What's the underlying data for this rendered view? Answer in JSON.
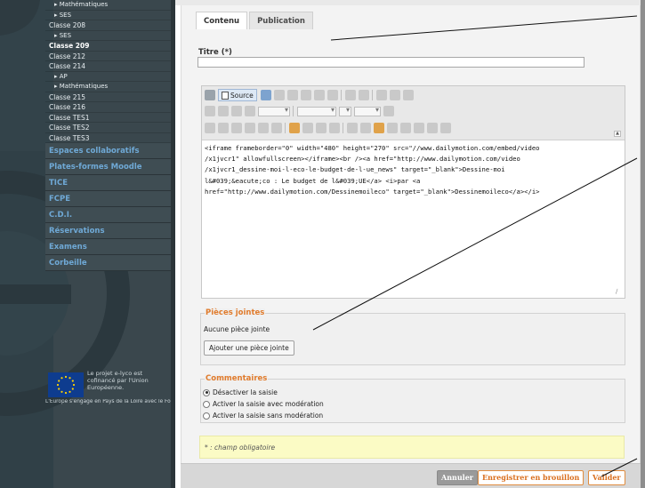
{
  "sidebar": {
    "top_items": [
      {
        "label": "▸ Mathématiques",
        "nested": true,
        "active": false
      },
      {
        "label": "▸ SES",
        "nested": true,
        "active": false
      },
      {
        "label": "Classe 208",
        "nested": false,
        "active": false
      },
      {
        "label": "▸ SES",
        "nested": true,
        "active": false
      },
      {
        "label": "Classe 209",
        "nested": false,
        "active": true
      },
      {
        "label": "Classe 212",
        "nested": false,
        "active": false
      },
      {
        "label": "Classe 214",
        "nested": false,
        "active": false
      },
      {
        "label": "▸ AP",
        "nested": true,
        "active": false
      },
      {
        "label": "▸ Mathématiques",
        "nested": true,
        "active": false
      },
      {
        "label": "Classe 215",
        "nested": false,
        "active": false
      },
      {
        "label": "Classe 216",
        "nested": false,
        "active": false
      },
      {
        "label": "Classe TES1",
        "nested": false,
        "active": false
      },
      {
        "label": "Classe TES2",
        "nested": false,
        "active": false
      },
      {
        "label": "Classe TES3",
        "nested": false,
        "active": false
      }
    ],
    "main_items": [
      {
        "label": "Espaces collaboratifs"
      },
      {
        "label": "Plates-formes Moodle"
      },
      {
        "label": "TICE"
      },
      {
        "label": "FCPE"
      },
      {
        "label": "C.D.I."
      },
      {
        "label": "Réservations"
      },
      {
        "label": "Examens"
      },
      {
        "label": "Corbeille"
      }
    ],
    "eu_text": "Le projet e-lyco est cofinancé par l'Union Européenne.",
    "eu_footer": "L'Europe s'engage en Pays de la Loire avec le Fonds Européen de Développement Régional"
  },
  "tabs": [
    {
      "label": "Contenu",
      "active": true
    },
    {
      "label": "Publication",
      "active": false
    }
  ],
  "form": {
    "title_label": "Titre (*)",
    "title_value": ""
  },
  "editor": {
    "source_label": "Source",
    "source_lines": [
      "<iframe frameborder=\"0\" width=\"480\" height=\"270\" src=\"//www.dailymotion.com/embed/video",
      "/x1jvcr1\" allowfullscreen></iframe><br /><a href=\"http://www.dailymotion.com/video",
      "/x1jvcr1_dessine-moi-l-eco-le-budget-de-l-ue_news\" target=\"_blank\">Dessine-moi",
      "l&#039;&eacute;co : Le budget de l&#039;UE</a> <i>par <a",
      "href=\"http://www.dailymotion.com/Dessinemoileco\" target=\"_blank\">Dessinemoileco</a></i>"
    ]
  },
  "attachments": {
    "legend": "Pièces jointes",
    "empty_text": "Aucune pièce jointe",
    "add_button": "Ajouter une pièce jointe"
  },
  "comments": {
    "legend": "Commentaires",
    "options": [
      {
        "label": "Désactiver la saisie",
        "checked": true
      },
      {
        "label": "Activer la saisie avec modération",
        "checked": false
      },
      {
        "label": "Activer la saisie sans modération",
        "checked": false
      }
    ]
  },
  "required_note": "* : champ obligatoire",
  "actions": {
    "cancel": "Annuler",
    "save_draft": "Enregistrer en brouillon",
    "validate": "Valider"
  },
  "colors": {
    "sidebar_bg": "#3a474d",
    "sidebar_link": "#6fa9d6",
    "accent_orange": "#e07b2c",
    "annotation_line": "#111111"
  }
}
